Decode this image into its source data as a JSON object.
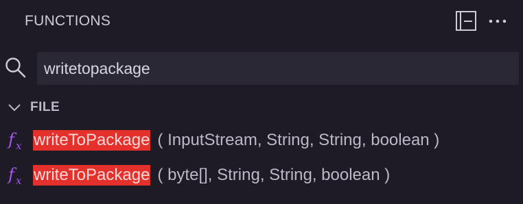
{
  "panel": {
    "title": "FUNCTIONS"
  },
  "toolbar": {
    "collapse_icon": "collapse-all-icon",
    "more_icon": "more-actions-icon"
  },
  "search": {
    "icon": "search-icon",
    "value": "writetopackage",
    "placeholder": ""
  },
  "group": {
    "label": "FILE",
    "expanded": true
  },
  "results": [
    {
      "icon": "function-icon",
      "name": "writeToPackage",
      "params": "( InputStream, String, String, boolean )"
    },
    {
      "icon": "function-icon",
      "name": "writeToPackage",
      "params": "( byte[], String, String, boolean )"
    }
  ],
  "colors": {
    "background": "#1e1b26",
    "search_background": "#2b2835",
    "match_highlight": "#e5312c",
    "function_icon": "#a855f7"
  }
}
